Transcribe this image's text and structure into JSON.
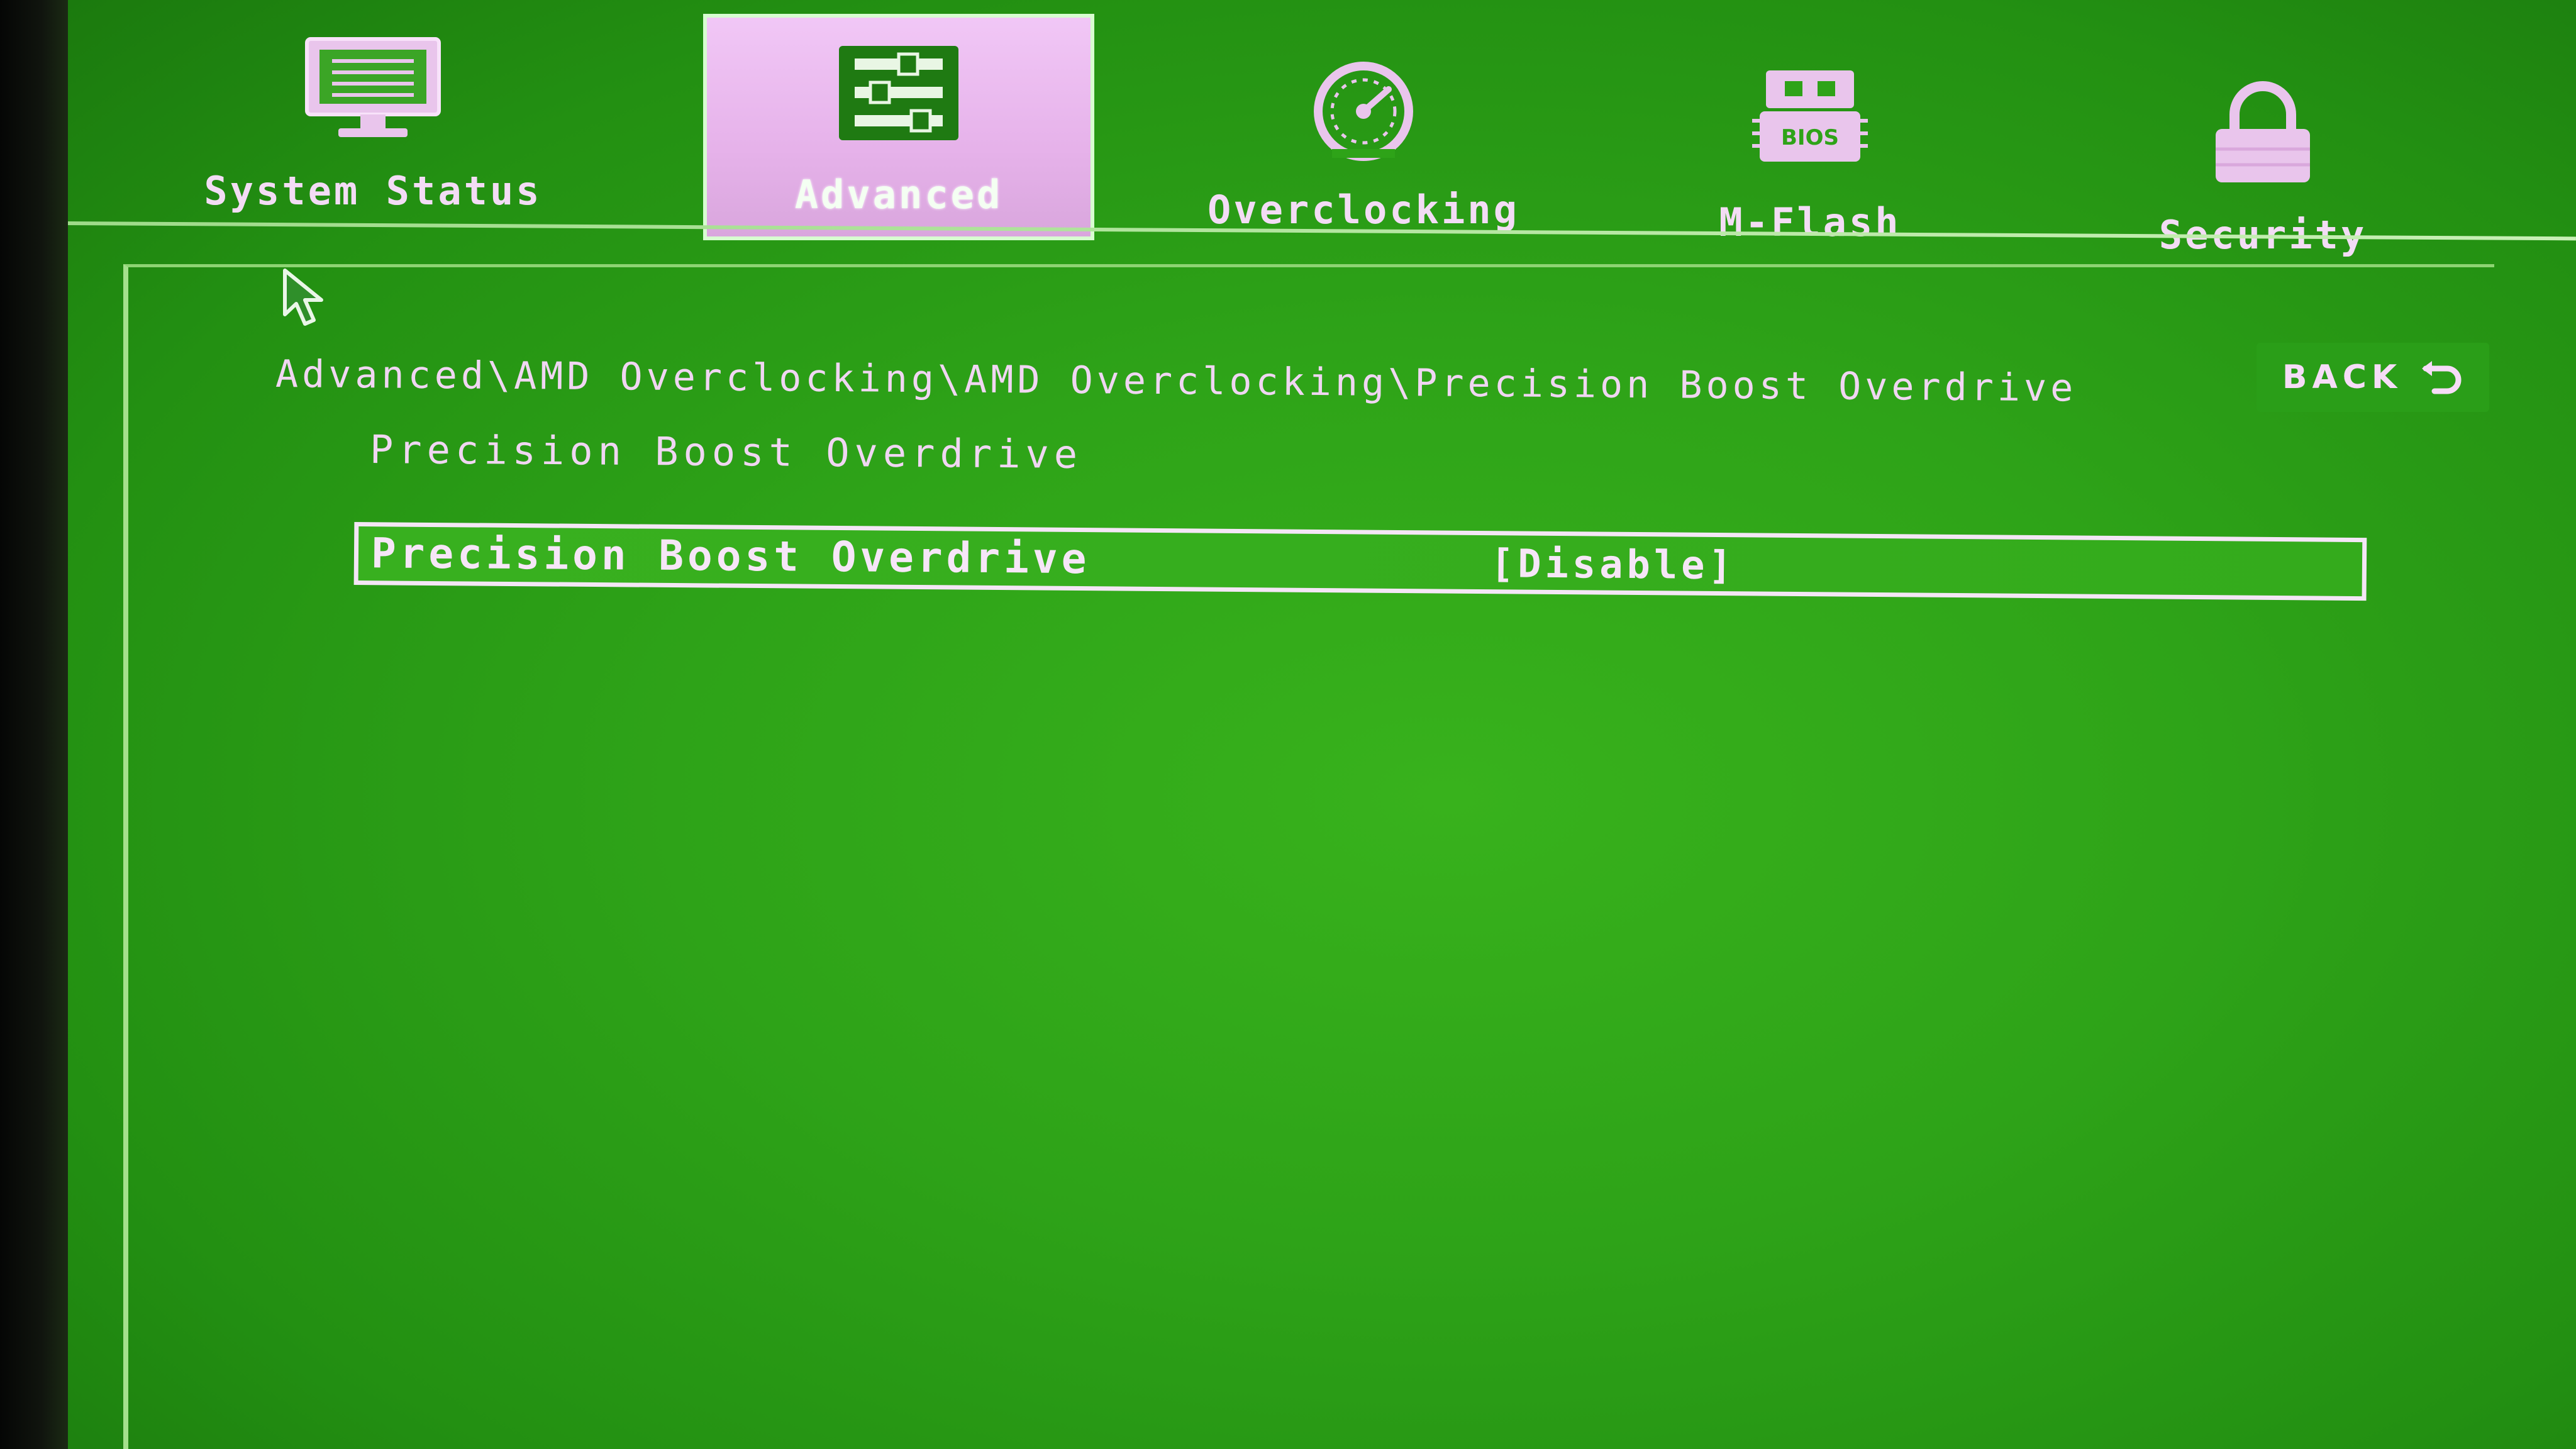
{
  "nav": {
    "tabs": [
      {
        "label": "System Status",
        "icon": "monitor-icon",
        "active": false
      },
      {
        "label": "Advanced",
        "icon": "sliders-icon",
        "active": true
      },
      {
        "label": "Overclocking",
        "icon": "speedometer-icon",
        "active": false
      },
      {
        "label": "M-Flash",
        "icon": "bios-chip-icon",
        "active": false
      },
      {
        "label": "Security",
        "icon": "padlock-icon",
        "active": false
      }
    ],
    "bios_chip_text": "BIOS"
  },
  "breadcrumb": "Advanced\\AMD Overclocking\\AMD Overclocking\\Precision Boost Overdrive",
  "section_title": "Precision Boost Overdrive",
  "back_button": {
    "label": "BACK",
    "icon": "return-arrow-icon"
  },
  "settings": [
    {
      "label": "Precision Boost Overdrive",
      "value": "[Disable]",
      "selected": true
    }
  ],
  "colors": {
    "background": "#2ea318",
    "text": "#f0d6f2",
    "active_tab": "#e6b2ea",
    "frame_line": "#a4e08c"
  }
}
